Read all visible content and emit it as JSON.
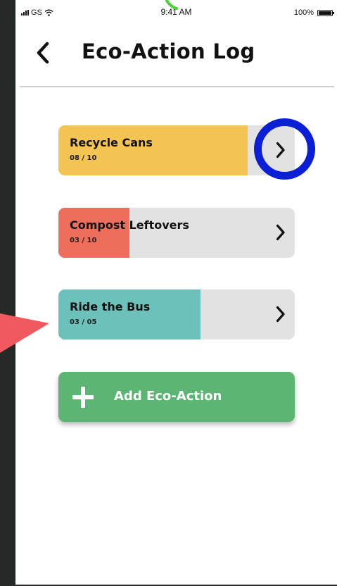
{
  "status_bar": {
    "carrier": "GS",
    "time": "9:41 AM",
    "battery": "100%"
  },
  "header": {
    "title": "Eco-Action Log",
    "back_icon": "chevron-left-icon"
  },
  "actions": [
    {
      "name": "Recycle Cans",
      "count": "08 / 10",
      "progress": 0.8,
      "color": "#f4c453"
    },
    {
      "name": "Compost Leftovers",
      "count": "03 / 10",
      "progress": 0.3,
      "color": "#ec6e5b"
    },
    {
      "name": "Ride the Bus",
      "count": "03 / 05",
      "progress": 0.6,
      "color": "#6cc2bb"
    }
  ],
  "add_button": {
    "label": "Add Eco-Action",
    "icon": "plus-icon",
    "color": "#5db574"
  },
  "annotations": {
    "highlight_color": "#0a1fd6",
    "pointer_color": "#f05a5f"
  }
}
